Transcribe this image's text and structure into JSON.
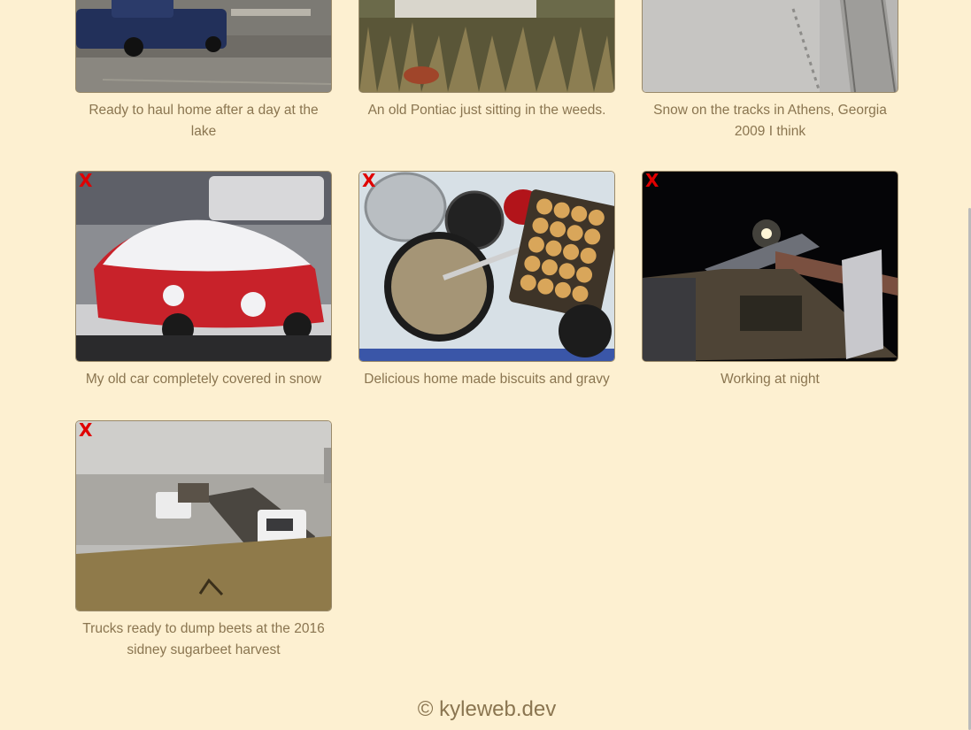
{
  "gallery": {
    "items": [
      {
        "caption": "Ready to haul home after a day at the lake",
        "image": "pickup-truck-trailer-photo",
        "delete": ""
      },
      {
        "caption": "An old Pontiac just sitting in the weeds.",
        "image": "old-pontiac-weeds-photo",
        "delete": ""
      },
      {
        "caption": "Snow on the tracks in Athens, Georgia 2009 I think",
        "image": "snowy-railroad-tracks-photo",
        "delete": ""
      },
      {
        "caption": "My old car completely covered in snow",
        "image": "snow-covered-red-car-photo",
        "delete": "X"
      },
      {
        "caption": "Delicious home made biscuits and gravy",
        "image": "biscuits-and-gravy-stove-photo",
        "delete": "X"
      },
      {
        "caption": "Working at night",
        "image": "night-conveyor-photo",
        "delete": "X"
      },
      {
        "caption": "Trucks ready to dump beets at the 2016 sidney sugarbeet harvest",
        "image": "beet-trucks-harvest-photo",
        "delete": "X"
      }
    ]
  },
  "footer": {
    "text": "© kyleweb.dev"
  },
  "colors": {
    "background": "#fdf0d1",
    "caption": "#8a7550",
    "delete": "#e00000"
  }
}
